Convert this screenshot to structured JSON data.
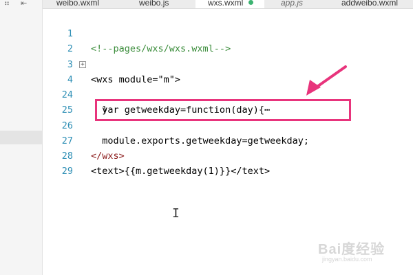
{
  "tabs": [
    {
      "label": "weibo.wxml",
      "active": false,
      "italic": false
    },
    {
      "label": "weibo.js",
      "active": false,
      "italic": false
    },
    {
      "label": "wxs.wxml",
      "active": true,
      "italic": false
    },
    {
      "label": "app.js",
      "active": false,
      "italic": true
    },
    {
      "label": "addweibo.wxml",
      "active": false,
      "italic": false
    }
  ],
  "editor": {
    "lines": [
      {
        "num": "1",
        "text": "<!--pages/wxs/wxs.wxml-->"
      },
      {
        "num": "2",
        "text": ""
      },
      {
        "num": "3",
        "text": "<wxs module=\"m\">"
      },
      {
        "num": "4",
        "text": "  var getweekday=function(day){⋯",
        "folded": true
      },
      {
        "num": "24",
        "text": "  }"
      },
      {
        "num": "25",
        "text": ""
      },
      {
        "num": "26",
        "text": "  module.exports.getweekday=getweekday;"
      },
      {
        "num": "27",
        "text": "</wxs>"
      },
      {
        "num": "28",
        "text": "<text>{{m.getweekday(1)}}</text>"
      },
      {
        "num": "29",
        "text": ""
      }
    ]
  },
  "annotation": {
    "color": "#e8347c"
  },
  "watermark": {
    "brand": "Bai度经验",
    "sub": "jingyan.baidu.com"
  },
  "icons": {
    "fold": "plus-square-icon",
    "caret": "text-cursor-icon"
  }
}
